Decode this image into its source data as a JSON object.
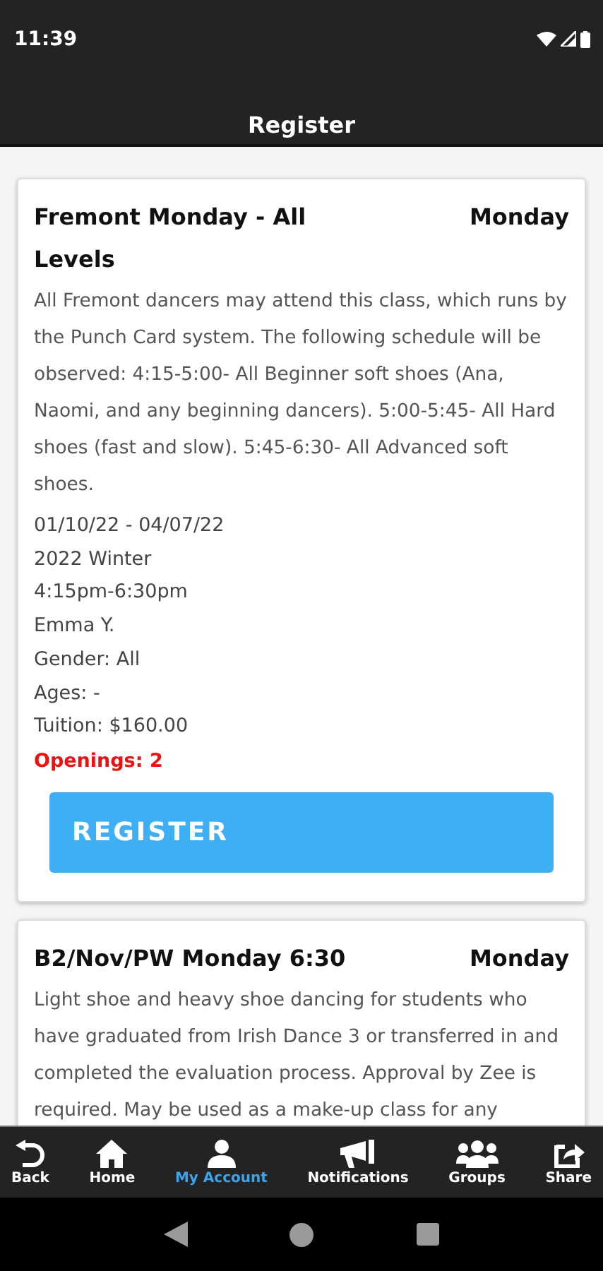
{
  "status_bar": {
    "time": "11:39"
  },
  "header": {
    "title": "Register"
  },
  "classes": [
    {
      "title": "Fremont Monday - All Levels",
      "day": "Monday",
      "description": "All Fremont dancers may attend this class, which runs by the Punch Card system. The following schedule will be observed: 4:15-5:00- All Beginner soft shoes (Ana, Naomi, and any beginning dancers). 5:00-5:45- All Hard shoes (fast and slow). 5:45-6:30- All Advanced soft shoes.",
      "details": [
        "01/10/22 - 04/07/22",
        "2022 Winter",
        "4:15pm-6:30pm",
        "Emma Y.",
        "Gender: All",
        "Ages: -",
        "Tuition: $160.00"
      ],
      "openings": "Openings: 2",
      "button": "REGISTER"
    },
    {
      "title": "B2/Nov/PW Monday 6:30",
      "day": "Monday",
      "description": "Light shoe and heavy shoe dancing for students who have graduated from Irish Dance 3 or transferred in and completed the evaluation process. Approval by Zee is required. May be used as a make-up class for any"
    }
  ],
  "nav": [
    {
      "label": "Back",
      "kind": "back",
      "selected": false
    },
    {
      "label": "Home",
      "kind": "home",
      "selected": false
    },
    {
      "label": "My Account",
      "kind": "account",
      "selected": true
    },
    {
      "label": "Notifications",
      "kind": "notifications",
      "selected": false
    },
    {
      "label": "Groups",
      "kind": "groups",
      "selected": false
    },
    {
      "label": "Share",
      "kind": "share",
      "selected": false
    }
  ]
}
